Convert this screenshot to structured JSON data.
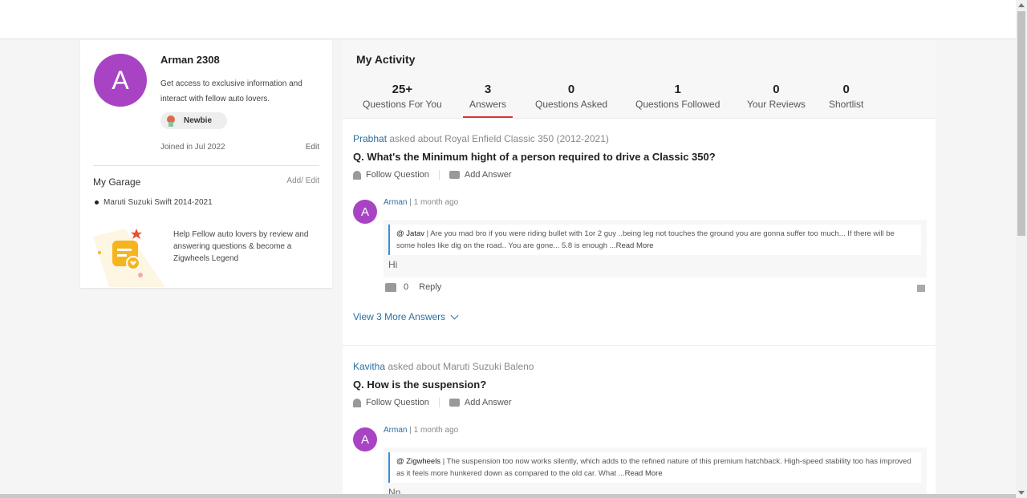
{
  "profile": {
    "avatar_letter": "A",
    "name": "Arman 2308",
    "description": "Get access to exclusive information and interact with fellow auto lovers.",
    "badge": "Newbie",
    "joined": "Joined in Jul 2022",
    "edit_label": "Edit"
  },
  "garage": {
    "title": "My Garage",
    "edit_label": "Add/ Edit",
    "items": [
      "Maruti Suzuki Swift 2014-2021"
    ],
    "legend_text": "Help Fellow auto lovers by review and answering questions & become a Zigwheels Legend"
  },
  "activity": {
    "title": "My Activity",
    "tabs": [
      {
        "count": "25+",
        "label": "Questions For You"
      },
      {
        "count": "3",
        "label": "Answers"
      },
      {
        "count": "0",
        "label": "Questions Asked"
      },
      {
        "count": "1",
        "label": "Questions Followed"
      },
      {
        "count": "0",
        "label": "Your Reviews"
      },
      {
        "count": "0",
        "label": "Shortlist"
      }
    ],
    "active_tab": "Answers"
  },
  "questions": [
    {
      "asker": "Prabhat",
      "about": " asked about Royal Enfield Classic 350 (2012-2021)",
      "text": "Q. What's the Minimum hight of a person required to drive a Classic 350?",
      "follow_label": "Follow Question",
      "answer_label": "Add Answer",
      "answer": {
        "avatar_letter": "A",
        "user": "Arman",
        "time": " | 1 month ago",
        "quote_user": "@ Jatav",
        "quote_text": " | Are you mad bro if you were riding bullet with 1or 2 guy ..being leg not touches the ground you are gonna suffer too much... If there will be some holes like dig on the road.. You are gone... 5.8 is enough ...",
        "read_more": "Read More",
        "reply_text": "Hi",
        "likes": "0",
        "reply_label": "Reply"
      },
      "view_more": "View 3 More Answers"
    },
    {
      "asker": "Kavitha",
      "about": " asked about Maruti Suzuki Baleno",
      "text": "Q. How is the suspension?",
      "follow_label": "Follow Question",
      "answer_label": "Add Answer",
      "answer": {
        "avatar_letter": "A",
        "user": "Arman",
        "time": " | 1 month ago",
        "quote_user": "@ Zigwheels",
        "quote_text": " | The suspension too now works silently, which adds to the refined nature of this premium hatchback. High-speed stability too has improved as it feels more hunkered down as compared to the old car. What ...",
        "read_more": "Read More",
        "reply_text": "Nn"
      }
    }
  ],
  "colors": {
    "avatar": "#a844c4",
    "link": "#2a6fa1",
    "active_tab": "#d93636",
    "quote_border": "#3a8ed8"
  }
}
